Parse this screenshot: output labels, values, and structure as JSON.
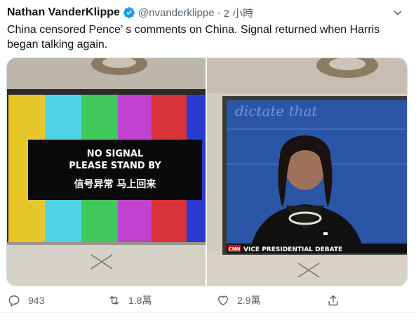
{
  "tweet": {
    "display_name": "Nathan VanderKlippe",
    "handle": "@nvanderklippe",
    "separator": "·",
    "time": "2 小時",
    "text": "China censored Pence’ s comments on China. Signal returned when Harris began talking again."
  },
  "media": {
    "left_screen": {
      "line1": "NO SIGNAL",
      "line2": "PLEASE STAND BY",
      "line3": "信号异常  马上回来"
    },
    "right_screen": {
      "network": "CNN",
      "chyron": "VICE PRESIDENTIAL DEBATE",
      "background_text": "dictate that"
    }
  },
  "actions": {
    "reply_count": "943",
    "retweet_count": "1.8萬",
    "like_count": "2.9萬"
  },
  "colors": {
    "text": "#0f1419",
    "secondary": "#536471",
    "verified": "#1d9bf0"
  }
}
